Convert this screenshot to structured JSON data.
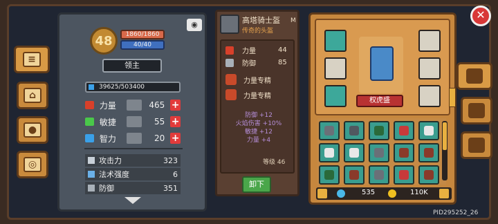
{
  "hero": {
    "level": "48",
    "hp": "1860/1860",
    "mp": "40/40",
    "title": "领主",
    "exp": "39625/503400"
  },
  "attributes": [
    {
      "name": "力量",
      "value": "465",
      "color": "#d8402a"
    },
    {
      "name": "敏捷",
      "value": "55",
      "color": "#4ac84a"
    },
    {
      "name": "智力",
      "value": "20",
      "color": "#3aa0e8"
    }
  ],
  "combat": [
    {
      "name": "攻击力",
      "value": "323"
    },
    {
      "name": "法术强度",
      "value": "6"
    },
    {
      "name": "防御",
      "value": "351"
    }
  ],
  "item": {
    "name": "高塔骑士盔",
    "tag": "M",
    "subtitle": "传奇的头盔",
    "stats": [
      {
        "name": "力量",
        "value": "44"
      },
      {
        "name": "防御",
        "value": "85"
      }
    ],
    "masteries": [
      "力量专精",
      "力量专精"
    ],
    "bonuses": [
      "防御 +12",
      "火焰伤害 +10%",
      "敏捷 +12",
      "力量 +4"
    ],
    "level_label": "等级 46",
    "unequip_label": "卸下"
  },
  "equip": {
    "hero_name": "权虎盛",
    "gems": "535",
    "coins": "110K"
  },
  "footer": {
    "pid": "PID295252_26"
  },
  "colors": {
    "teal_slot": "#3da89a",
    "close_red": "#d83838",
    "panel_orange": "#c6873e"
  }
}
